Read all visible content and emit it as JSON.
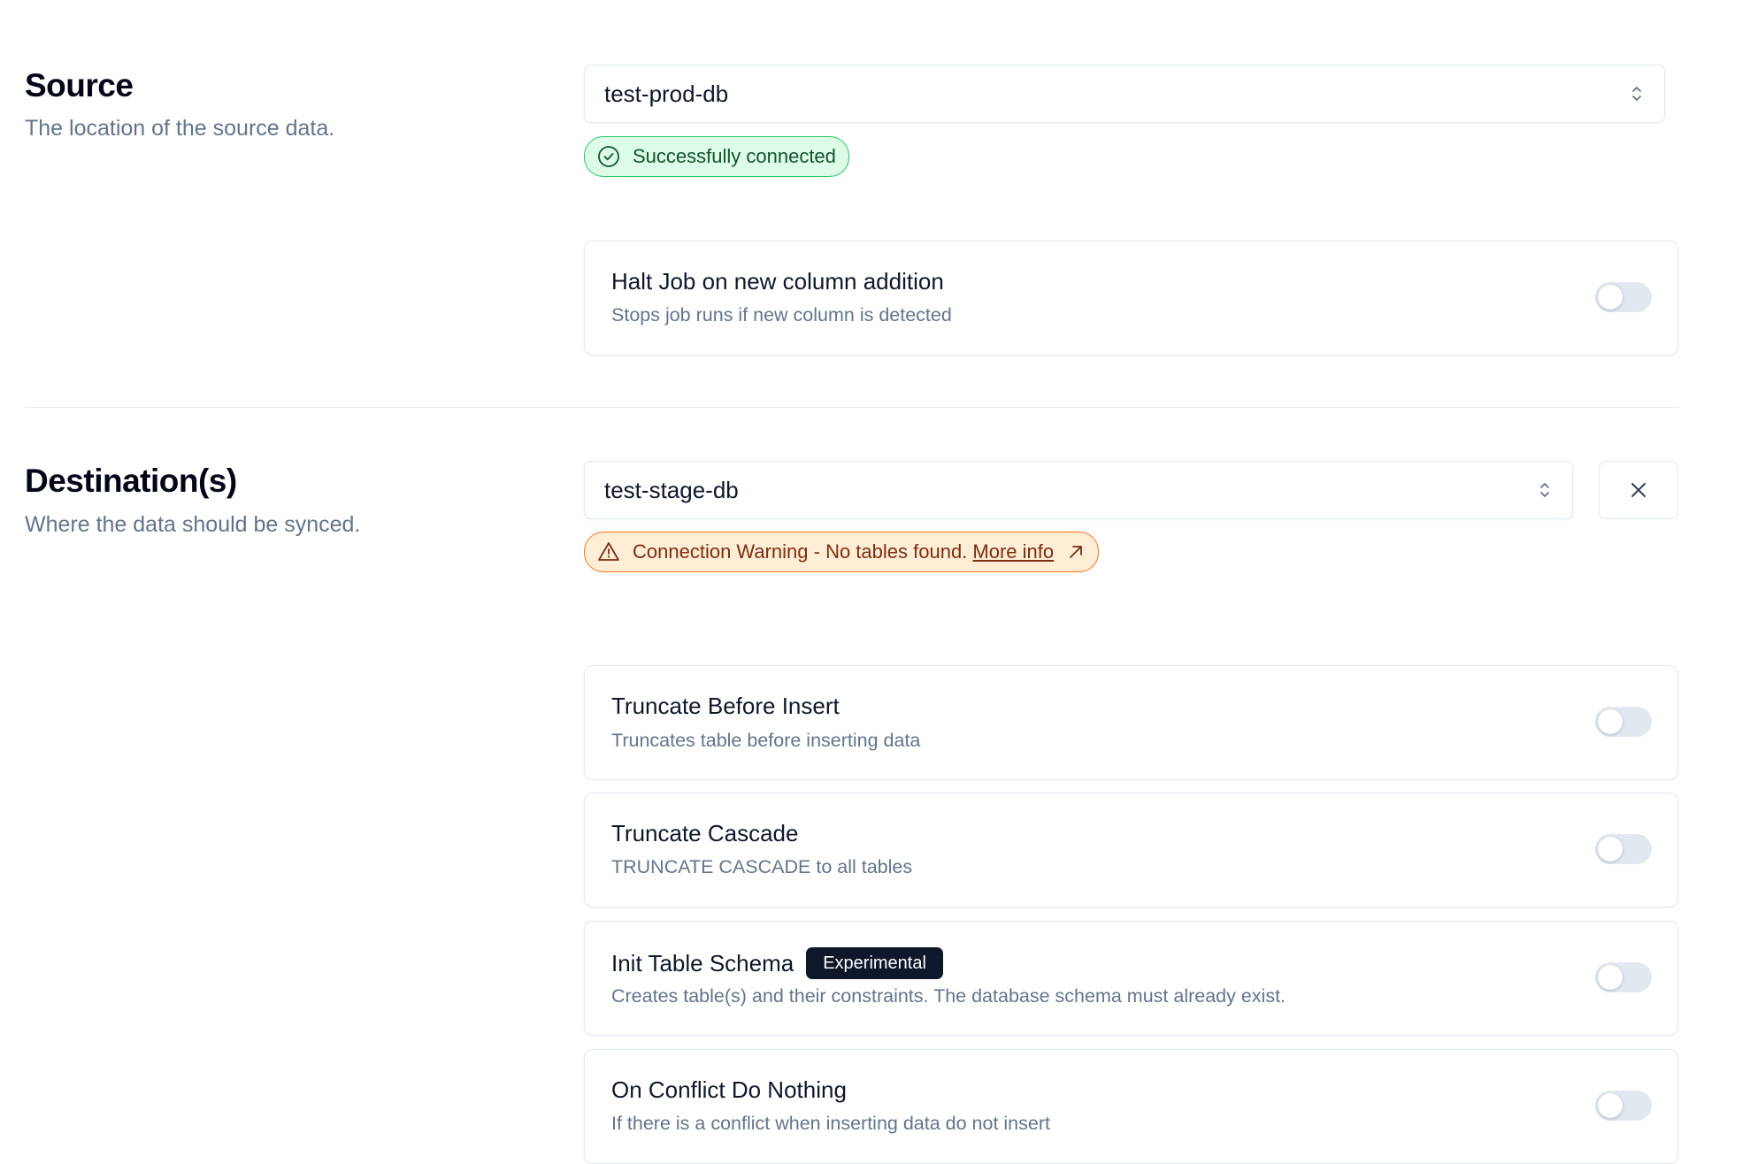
{
  "source": {
    "title": "Source",
    "description": "The location of the source data.",
    "select_value": "test-prod-db",
    "status": {
      "text": "Successfully connected",
      "icon": "check-circle-icon",
      "color": "#22c55e"
    },
    "options": [
      {
        "title": "Halt Job on new column addition",
        "description": "Stops job runs if new column is detected",
        "enabled": false
      }
    ]
  },
  "destination": {
    "title": "Destination(s)",
    "description": "Where the data should be synced.",
    "select_value": "test-stage-db",
    "warning": {
      "text": "Connection Warning - No tables found.",
      "link_text": "More info",
      "icon": "alert-triangle-icon",
      "link_icon": "arrow-up-right-icon",
      "color": "#f97316"
    },
    "options": [
      {
        "title": "Truncate Before Insert",
        "description": "Truncates table before inserting data",
        "enabled": false
      },
      {
        "title": "Truncate Cascade",
        "description": "TRUNCATE CASCADE to all tables",
        "enabled": false
      },
      {
        "title": "Init Table Schema",
        "badge": "Experimental",
        "description": "Creates table(s) and their constraints. The database schema must already exist.",
        "enabled": false
      },
      {
        "title": "On Conflict Do Nothing",
        "description": "If there is a conflict when inserting data do not insert",
        "enabled": false
      }
    ]
  }
}
